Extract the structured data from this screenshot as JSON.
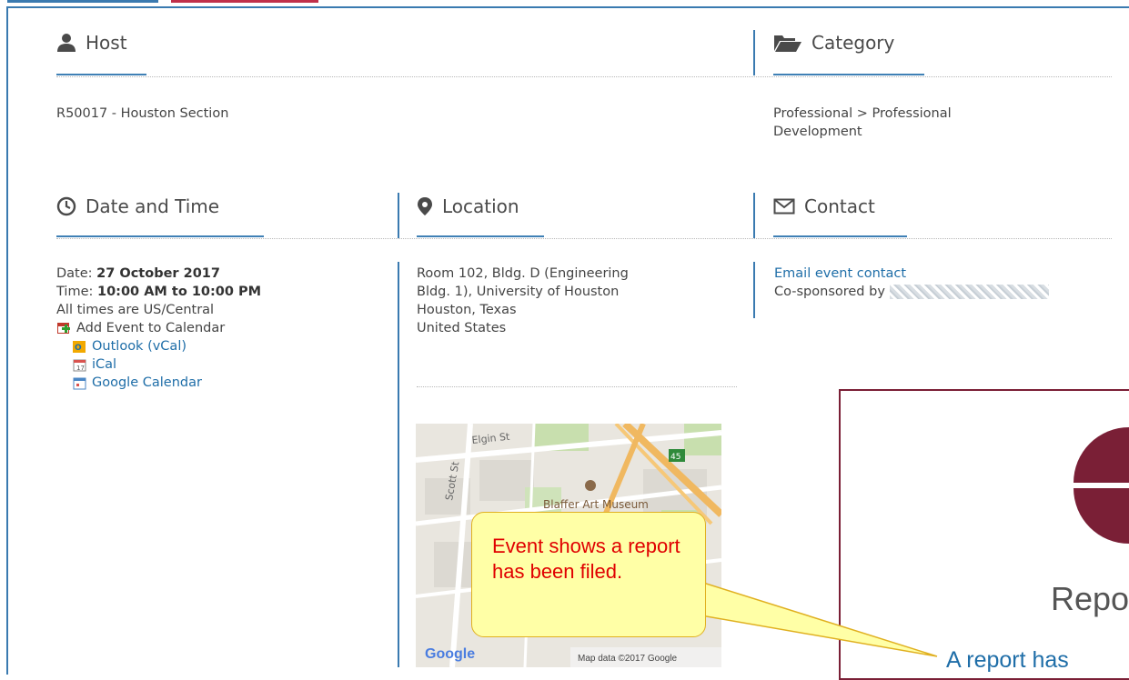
{
  "host": {
    "title": "Host",
    "value": "R50017 - Houston Section"
  },
  "category": {
    "title": "Category",
    "value_line1": "Professional > Professional",
    "value_line2": "Development"
  },
  "datetime": {
    "title": "Date and Time",
    "date_label": "Date:",
    "date_value": "27 October 2017",
    "time_label": "Time:",
    "time_value": "10:00 AM to 10:00 PM",
    "timezone_note": "All times are US/Central",
    "add_calendar": "Add Event to Calendar",
    "calendar_options": [
      "Outlook (vCal)",
      "iCal",
      "Google Calendar"
    ]
  },
  "location": {
    "title": "Location",
    "line1": "Room 102, Bldg. D (Engineering",
    "line2": "Bldg. 1), University of Houston",
    "line3": "Houston, Texas",
    "line4": "United States"
  },
  "contact": {
    "title": "Contact",
    "email_link": "Email event contact",
    "cosponsored": "Co-sponsored by"
  },
  "map": {
    "street1": "Elgin St",
    "street2": "Scott St",
    "highway": "45",
    "poi": "Blaffer Art Museum",
    "logo": "Google",
    "attribution": "Map data ©2017 Google"
  },
  "report": {
    "heading": "Repo",
    "message": "A report has"
  },
  "callout": {
    "text": "Event shows a report has been filed."
  },
  "colors": {
    "accent": "#3a7ab0",
    "link": "#1f6ea8",
    "report_maroon": "#7a1f36",
    "callout_bg": "#ffffa6",
    "callout_text": "#e00000"
  }
}
